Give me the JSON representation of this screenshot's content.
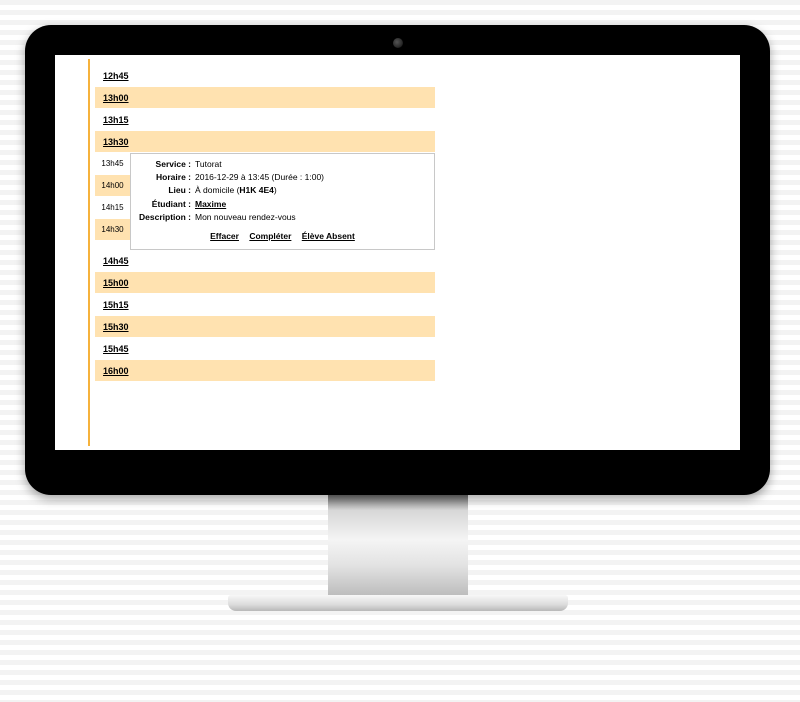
{
  "times_top": [
    "12h45",
    "13h00",
    "13h15",
    "13h30"
  ],
  "times_side": [
    "13h45",
    "14h00",
    "14h15",
    "14h30"
  ],
  "times_bottom": [
    "14h45",
    "15h00",
    "15h15",
    "15h30",
    "15h45",
    "16h00"
  ],
  "detail": {
    "service_label": "Service :",
    "service_value": "Tutorat",
    "horaire_label": "Horaire :",
    "horaire_value": "2016-12-29 à 13:45 (Durée : 1:00)",
    "lieu_label": "Lieu :",
    "lieu_text": "À domicile (",
    "lieu_code": "H1K 4E4",
    "lieu_after": ")",
    "etudiant_label": "Étudiant :",
    "etudiant_link": "Maxime",
    "description_label": "Description :",
    "description_value": "Mon nouveau rendez-vous",
    "action_effacer": "Effacer",
    "action_completer": "Compléter",
    "action_absent": "Élève Absent"
  }
}
